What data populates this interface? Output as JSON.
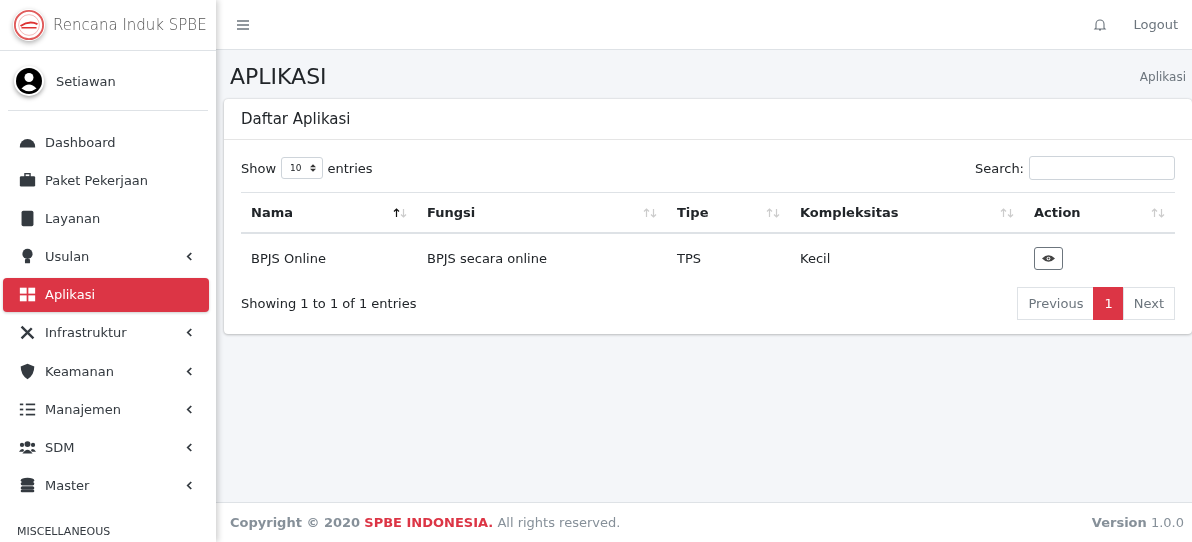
{
  "brand": {
    "title": "Rencana Induk SPBE"
  },
  "user": {
    "name": "Setiawan"
  },
  "sidebar": {
    "items": [
      {
        "label": "Dashboard",
        "selected": false,
        "expandable": false
      },
      {
        "label": "Paket Pekerjaan",
        "selected": false,
        "expandable": false
      },
      {
        "label": "Layanan",
        "selected": false,
        "expandable": false
      },
      {
        "label": "Usulan",
        "selected": false,
        "expandable": true
      },
      {
        "label": "Aplikasi",
        "selected": true,
        "expandable": false
      },
      {
        "label": "Infrastruktur",
        "selected": false,
        "expandable": true
      },
      {
        "label": "Keamanan",
        "selected": false,
        "expandable": true
      },
      {
        "label": "Manajemen",
        "selected": false,
        "expandable": true
      },
      {
        "label": "SDM",
        "selected": false,
        "expandable": true
      },
      {
        "label": "Master",
        "selected": false,
        "expandable": true
      }
    ],
    "section_header": "MISCELLANEOUS"
  },
  "topbar": {
    "logout": "Logout"
  },
  "page": {
    "title": "APLIKASI",
    "breadcrumb": "Aplikasi"
  },
  "card": {
    "title": "Daftar Aplikasi",
    "length": {
      "show": "Show",
      "value": "10",
      "entries": "entries"
    },
    "search": {
      "label": "Search:"
    },
    "table": {
      "columns": [
        {
          "label": "Nama",
          "sorted": true
        },
        {
          "label": "Fungsi",
          "sorted": false
        },
        {
          "label": "Tipe",
          "sorted": false
        },
        {
          "label": "Kompleksitas",
          "sorted": false
        },
        {
          "label": "Action",
          "sorted": false
        }
      ],
      "rows": [
        {
          "cells": [
            "BPJS Online",
            "BPJS secara online",
            "TPS",
            "Kecil"
          ]
        }
      ]
    },
    "info": "Showing 1 to 1 of 1 entries",
    "pagination": [
      {
        "label": "Previous",
        "selected": false
      },
      {
        "label": "1",
        "selected": true
      },
      {
        "label": "Next",
        "selected": false
      }
    ]
  },
  "footer": {
    "copyright": "Copyright © 2020",
    "brand": "SPBE INDONESIA.",
    "rights": "All rights reserved.",
    "version": "**Version** 1.0.0"
  }
}
